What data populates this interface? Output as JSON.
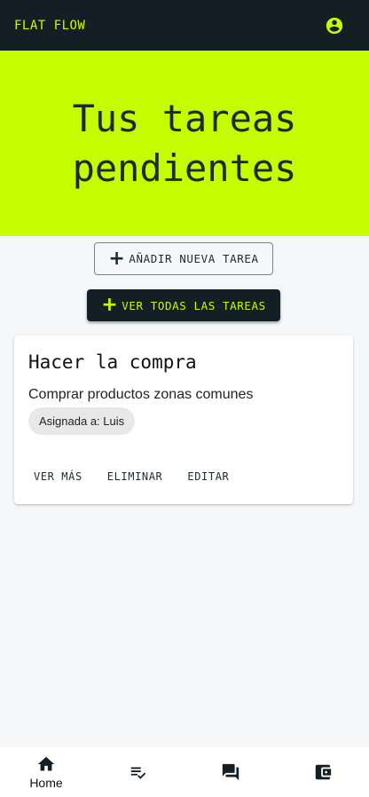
{
  "app": {
    "brand": "FLAT FLOW"
  },
  "header": {
    "account_icon": "account-circle-icon"
  },
  "hero": {
    "line1": "Tus tareas",
    "line2": "pendientes",
    "background": "#c6fc00"
  },
  "buttons": {
    "add_task": {
      "label": "AÑADIR NUEVA TAREA",
      "icon": "plus-icon"
    },
    "view_all": {
      "label": "VER TODAS LAS TAREAS",
      "icon": "plus-icon"
    }
  },
  "tasks": [
    {
      "title": "Hacer la compra",
      "description": "Comprar productos zonas comunes",
      "assignee_chip": "Asignada a: Luis",
      "actions": [
        "VER MÁS",
        "ELIMINAR",
        "EDITAR"
      ]
    }
  ],
  "bottom_nav": [
    {
      "label": "Home",
      "icon": "home-icon"
    },
    {
      "label": "",
      "icon": "checklist-icon"
    },
    {
      "label": "",
      "icon": "chat-icon"
    },
    {
      "label": "",
      "icon": "wallet-icon"
    }
  ],
  "colors": {
    "dark": "#141e25",
    "accent": "#c6fc00"
  }
}
